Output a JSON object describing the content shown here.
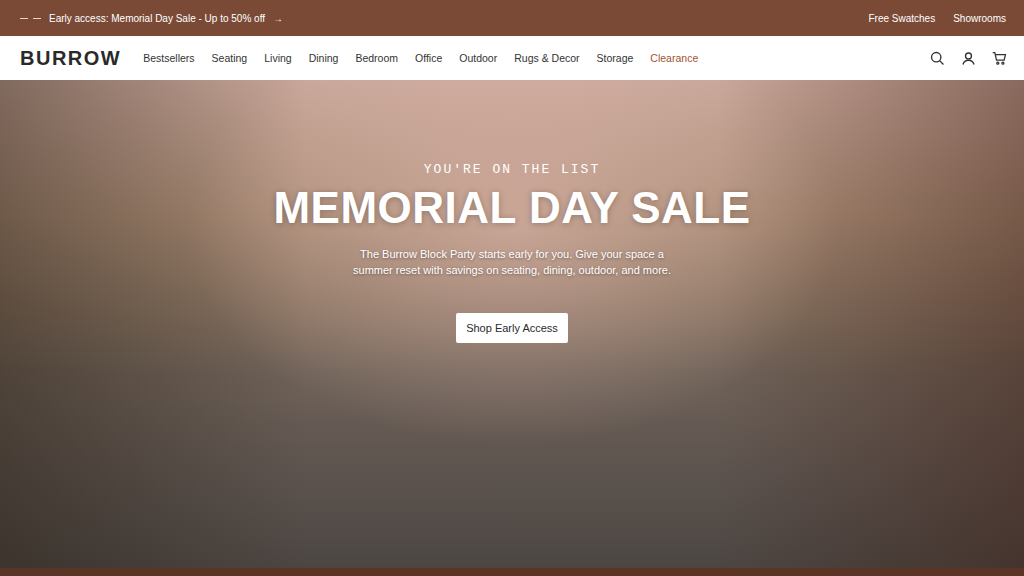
{
  "announcement": {
    "text": "Early access: Memorial Day Sale - Up to 50% off",
    "arrow": "→"
  },
  "utility_links": [
    "Free Swatches",
    "Showrooms"
  ],
  "logo": "BURROW",
  "nav": [
    {
      "label": "Bestsellers",
      "color": "#333333"
    },
    {
      "label": "Seating",
      "color": "#333333"
    },
    {
      "label": "Living",
      "color": "#333333"
    },
    {
      "label": "Dining",
      "color": "#333333"
    },
    {
      "label": "Bedroom",
      "color": "#333333"
    },
    {
      "label": "Office",
      "color": "#333333"
    },
    {
      "label": "Outdoor",
      "color": "#333333"
    },
    {
      "label": "Rugs & Decor",
      "color": "#333333"
    },
    {
      "label": "Storage",
      "color": "#333333"
    },
    {
      "label": "Clearance",
      "color": "#a4532f"
    }
  ],
  "hero": {
    "eyebrow": "YOU'RE ON THE LIST",
    "title": "MEMORIAL DAY SALE",
    "body": "The Burrow Block Party starts early for you. Give your space a summer reset with savings on seating, dining, outdoor, and more.",
    "button": "Shop Early Access"
  }
}
